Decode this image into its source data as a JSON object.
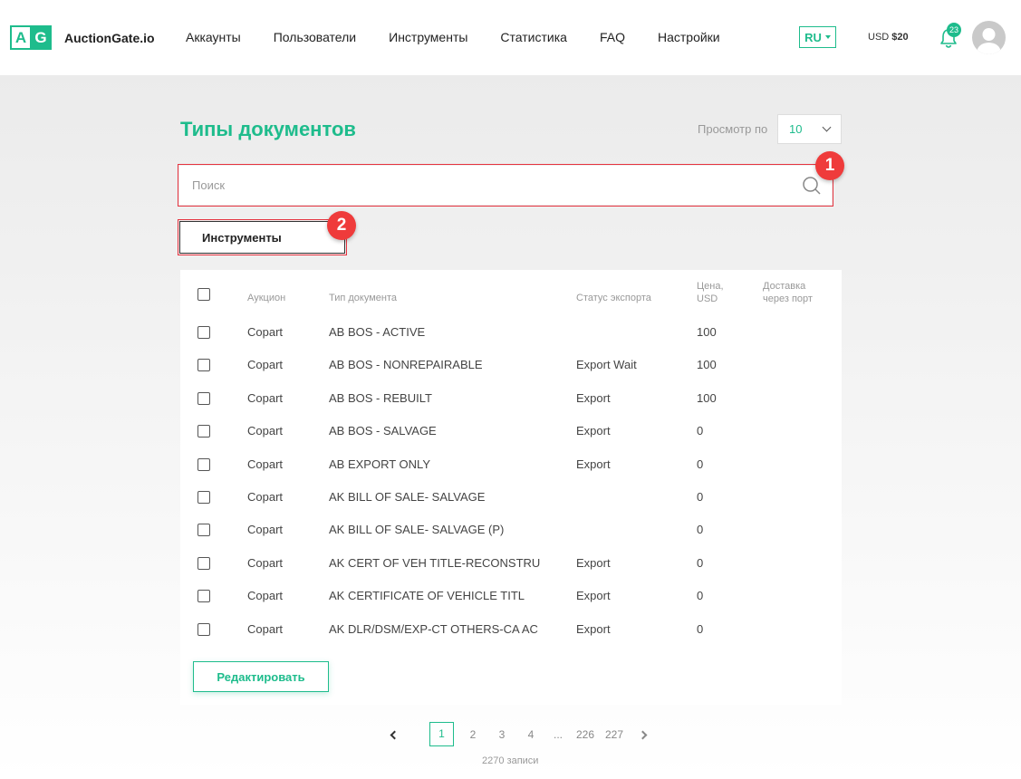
{
  "header": {
    "logo_letters": [
      "A",
      "G"
    ],
    "brand": "AuctionGate.io",
    "nav": [
      "Аккаунты",
      "Пользователи",
      "Инструменты",
      "Статистика",
      "FAQ",
      "Настройки"
    ],
    "lang": "RU",
    "currency": "USD",
    "balance": "$20",
    "notifications": "23"
  },
  "page": {
    "title": "Типы документов",
    "per_page_label": "Просмотр по",
    "per_page_value": "10",
    "search_placeholder": "Поиск",
    "tools_label": "Инструменты",
    "markers": [
      "1",
      "2"
    ]
  },
  "table": {
    "headers": {
      "auction": "Аукцион",
      "type": "Тип документа",
      "status": "Статус экспорта",
      "price": [
        "Цена,",
        "USD"
      ],
      "delivery": [
        "Доставка",
        "через порт"
      ]
    },
    "rows": [
      {
        "auction": "Copart",
        "type": "AB BOS - ACTIVE",
        "status": "",
        "price": "100",
        "delivery": ""
      },
      {
        "auction": "Copart",
        "type": "AB BOS - NONREPAIRABLE",
        "status": "Export Wait",
        "price": "100",
        "delivery": ""
      },
      {
        "auction": "Copart",
        "type": "AB BOS - REBUILT",
        "status": "Export",
        "price": "100",
        "delivery": ""
      },
      {
        "auction": "Copart",
        "type": "AB BOS - SALVAGE",
        "status": "Export",
        "price": "0",
        "delivery": ""
      },
      {
        "auction": "Copart",
        "type": "AB EXPORT ONLY",
        "status": "Export",
        "price": "0",
        "delivery": ""
      },
      {
        "auction": "Copart",
        "type": "AK BILL OF SALE- SALVAGE",
        "status": "",
        "price": "0",
        "delivery": ""
      },
      {
        "auction": "Copart",
        "type": "AK BILL OF SALE- SALVAGE (P)",
        "status": "",
        "price": "0",
        "delivery": ""
      },
      {
        "auction": "Copart",
        "type": "AK CERT OF VEH TITLE-RECONSTRU",
        "status": "Export",
        "price": "0",
        "delivery": ""
      },
      {
        "auction": "Copart",
        "type": "AK CERTIFICATE OF VEHICLE TITL",
        "status": "Export",
        "price": "0",
        "delivery": ""
      },
      {
        "auction": "Copart",
        "type": "AK DLR/DSM/EXP-CT OTHERS-CA AC",
        "status": "Export",
        "price": "0",
        "delivery": ""
      }
    ],
    "edit_label": "Редактировать"
  },
  "pagination": {
    "pages": [
      "1",
      "2",
      "3",
      "4",
      "...",
      "226",
      "227"
    ],
    "current": "1",
    "records": "2270 записи"
  },
  "colors": {
    "accent": "#1ebc8c",
    "marker": "#ef3b3b"
  },
  "icons": [
    "search-icon",
    "bell-icon",
    "avatar-icon",
    "chevron-down-icon",
    "chevron-left-icon",
    "chevron-right-icon"
  ]
}
